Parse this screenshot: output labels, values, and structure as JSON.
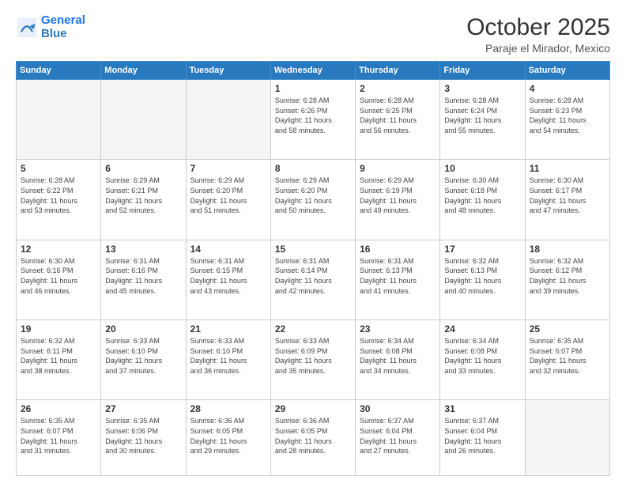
{
  "logo": {
    "line1": "General",
    "line2": "Blue"
  },
  "header": {
    "month": "October 2025",
    "location": "Paraje el Mirador, Mexico"
  },
  "weekdays": [
    "Sunday",
    "Monday",
    "Tuesday",
    "Wednesday",
    "Thursday",
    "Friday",
    "Saturday"
  ],
  "weeks": [
    [
      {
        "day": "",
        "info": ""
      },
      {
        "day": "",
        "info": ""
      },
      {
        "day": "",
        "info": ""
      },
      {
        "day": "1",
        "info": "Sunrise: 6:28 AM\nSunset: 6:26 PM\nDaylight: 11 hours\nand 58 minutes."
      },
      {
        "day": "2",
        "info": "Sunrise: 6:28 AM\nSunset: 6:25 PM\nDaylight: 11 hours\nand 56 minutes."
      },
      {
        "day": "3",
        "info": "Sunrise: 6:28 AM\nSunset: 6:24 PM\nDaylight: 11 hours\nand 55 minutes."
      },
      {
        "day": "4",
        "info": "Sunrise: 6:28 AM\nSunset: 6:23 PM\nDaylight: 11 hours\nand 54 minutes."
      }
    ],
    [
      {
        "day": "5",
        "info": "Sunrise: 6:28 AM\nSunset: 6:22 PM\nDaylight: 11 hours\nand 53 minutes."
      },
      {
        "day": "6",
        "info": "Sunrise: 6:29 AM\nSunset: 6:21 PM\nDaylight: 11 hours\nand 52 minutes."
      },
      {
        "day": "7",
        "info": "Sunrise: 6:29 AM\nSunset: 6:20 PM\nDaylight: 11 hours\nand 51 minutes."
      },
      {
        "day": "8",
        "info": "Sunrise: 6:29 AM\nSunset: 6:20 PM\nDaylight: 11 hours\nand 50 minutes."
      },
      {
        "day": "9",
        "info": "Sunrise: 6:29 AM\nSunset: 6:19 PM\nDaylight: 11 hours\nand 49 minutes."
      },
      {
        "day": "10",
        "info": "Sunrise: 6:30 AM\nSunset: 6:18 PM\nDaylight: 11 hours\nand 48 minutes."
      },
      {
        "day": "11",
        "info": "Sunrise: 6:30 AM\nSunset: 6:17 PM\nDaylight: 11 hours\nand 47 minutes."
      }
    ],
    [
      {
        "day": "12",
        "info": "Sunrise: 6:30 AM\nSunset: 6:16 PM\nDaylight: 11 hours\nand 46 minutes."
      },
      {
        "day": "13",
        "info": "Sunrise: 6:31 AM\nSunset: 6:16 PM\nDaylight: 11 hours\nand 45 minutes."
      },
      {
        "day": "14",
        "info": "Sunrise: 6:31 AM\nSunset: 6:15 PM\nDaylight: 11 hours\nand 43 minutes."
      },
      {
        "day": "15",
        "info": "Sunrise: 6:31 AM\nSunset: 6:14 PM\nDaylight: 11 hours\nand 42 minutes."
      },
      {
        "day": "16",
        "info": "Sunrise: 6:31 AM\nSunset: 6:13 PM\nDaylight: 11 hours\nand 41 minutes."
      },
      {
        "day": "17",
        "info": "Sunrise: 6:32 AM\nSunset: 6:13 PM\nDaylight: 11 hours\nand 40 minutes."
      },
      {
        "day": "18",
        "info": "Sunrise: 6:32 AM\nSunset: 6:12 PM\nDaylight: 11 hours\nand 39 minutes."
      }
    ],
    [
      {
        "day": "19",
        "info": "Sunrise: 6:32 AM\nSunset: 6:11 PM\nDaylight: 11 hours\nand 38 minutes."
      },
      {
        "day": "20",
        "info": "Sunrise: 6:33 AM\nSunset: 6:10 PM\nDaylight: 11 hours\nand 37 minutes."
      },
      {
        "day": "21",
        "info": "Sunrise: 6:33 AM\nSunset: 6:10 PM\nDaylight: 11 hours\nand 36 minutes."
      },
      {
        "day": "22",
        "info": "Sunrise: 6:33 AM\nSunset: 6:09 PM\nDaylight: 11 hours\nand 35 minutes."
      },
      {
        "day": "23",
        "info": "Sunrise: 6:34 AM\nSunset: 6:08 PM\nDaylight: 11 hours\nand 34 minutes."
      },
      {
        "day": "24",
        "info": "Sunrise: 6:34 AM\nSunset: 6:08 PM\nDaylight: 11 hours\nand 33 minutes."
      },
      {
        "day": "25",
        "info": "Sunrise: 6:35 AM\nSunset: 6:07 PM\nDaylight: 11 hours\nand 32 minutes."
      }
    ],
    [
      {
        "day": "26",
        "info": "Sunrise: 6:35 AM\nSunset: 6:07 PM\nDaylight: 11 hours\nand 31 minutes."
      },
      {
        "day": "27",
        "info": "Sunrise: 6:35 AM\nSunset: 6:06 PM\nDaylight: 11 hours\nand 30 minutes."
      },
      {
        "day": "28",
        "info": "Sunrise: 6:36 AM\nSunset: 6:05 PM\nDaylight: 11 hours\nand 29 minutes."
      },
      {
        "day": "29",
        "info": "Sunrise: 6:36 AM\nSunset: 6:05 PM\nDaylight: 11 hours\nand 28 minutes."
      },
      {
        "day": "30",
        "info": "Sunrise: 6:37 AM\nSunset: 6:04 PM\nDaylight: 11 hours\nand 27 minutes."
      },
      {
        "day": "31",
        "info": "Sunrise: 6:37 AM\nSunset: 6:04 PM\nDaylight: 11 hours\nand 26 minutes."
      },
      {
        "day": "",
        "info": ""
      }
    ]
  ]
}
